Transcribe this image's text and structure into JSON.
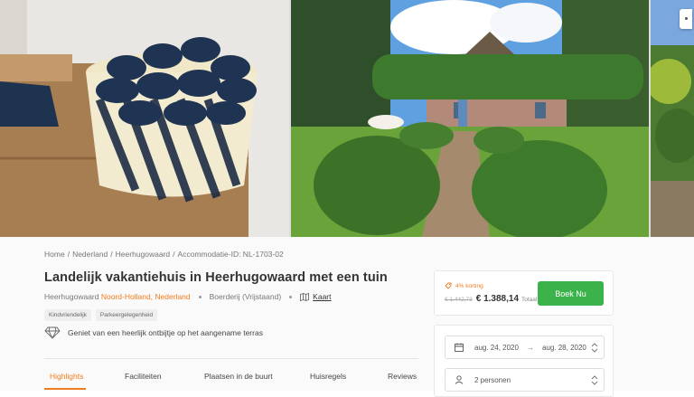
{
  "gallery": {
    "photos": [
      {
        "icon": "towel-basket-photo"
      },
      {
        "icon": "farmhouse-garden-photo"
      },
      {
        "icon": "garden-photo"
      }
    ]
  },
  "breadcrumb": {
    "home": "Home",
    "country": "Nederland",
    "city": "Heerhugowaard",
    "id": "Accommodatie-ID: NL-1703-02",
    "separator": "/"
  },
  "title": "Landelijk vakantiehuis in Heerhugowaard met een tuin",
  "location": {
    "town": "Heerhugowaard",
    "province": "Noord-Holland,",
    "country": "Nederland",
    "type": "Boerderij (Vrijstaand)",
    "map_label": "Kaart"
  },
  "tags": [
    "Kindvriendelijk",
    "Parkeergelegenheid"
  ],
  "highlight": "Geniet van een heerlijk ontbijtje op het aangename terras",
  "tabs": [
    "Highlights",
    "Faciliteiten",
    "Plaatsen in de buurt",
    "Huisregels",
    "Reviews"
  ],
  "price": {
    "discount": "4% korting",
    "old": "€ 1.442,73",
    "new": "€ 1.388,14",
    "total_label": "Totaal",
    "book_label": "Boek Nu"
  },
  "booking": {
    "date_from": "aug. 24, 2020",
    "arrow": "→",
    "date_to": "aug. 28, 2020",
    "guests": "2 personen"
  },
  "colors": {
    "accent": "#f07d1e",
    "book": "#3cb24a"
  }
}
